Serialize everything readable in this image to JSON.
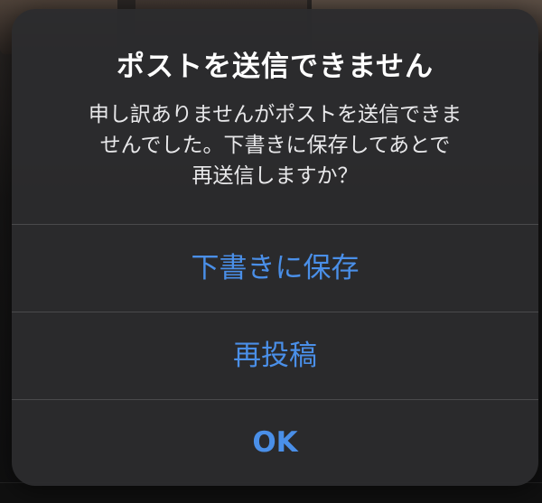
{
  "dialog": {
    "title": "ポストを送信できません",
    "message_lines": [
      "申し訳ありませんがポストを送信できま",
      "せんでした。下書きに保存してあとで",
      "再送信しますか？"
    ],
    "actions": [
      {
        "label": "下書きに保存",
        "style": "default"
      },
      {
        "label": "再投稿",
        "style": "default"
      },
      {
        "label": "OK",
        "style": "bold"
      }
    ]
  },
  "colors": {
    "dialog_background": "#2c2c2e",
    "action_text": "#4a8fe8",
    "title_text": "#ffffff",
    "separator": "#4a4a4c"
  }
}
